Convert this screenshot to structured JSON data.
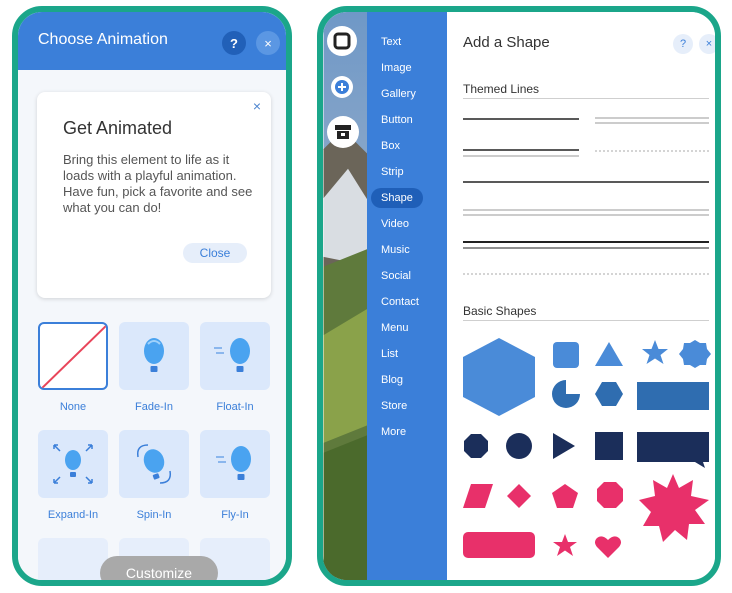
{
  "animation_panel": {
    "title": "Choose Animation",
    "help_label": "?",
    "close_label": "×",
    "tip": {
      "close_x": "×",
      "title": "Get Animated",
      "text": "Bring this element to life as it loads with a playful animation. Have fun, pick a favorite and see what you can do!",
      "close_button": "Close"
    },
    "animations": [
      {
        "label": "None",
        "icon": "none-slash-icon",
        "selected": true
      },
      {
        "label": "Fade-In",
        "icon": "balloon-icon"
      },
      {
        "label": "Float-In",
        "icon": "float-balloon-icon"
      },
      {
        "label": "Expand-In",
        "icon": "expand-balloon-icon"
      },
      {
        "label": "Spin-In",
        "icon": "spin-balloon-icon"
      },
      {
        "label": "Fly-In",
        "icon": "fly-balloon-icon"
      }
    ],
    "customize_button": "Customize"
  },
  "editor": {
    "add_menu": {
      "items": [
        "Text",
        "Image",
        "Gallery",
        "Button",
        "Box",
        "Strip",
        "Shape",
        "Video",
        "Music",
        "Social",
        "Contact",
        "Menu",
        "List",
        "Blog",
        "Store",
        "More"
      ],
      "active": "Shape"
    },
    "shape_panel": {
      "title": "Add a Shape",
      "help_label": "?",
      "close_label": "×",
      "themed_lines_title": "Themed Lines",
      "basic_shapes_title": "Basic Shapes"
    },
    "colors": {
      "accent_blue": "#3b7fd9",
      "shape_blue": "#4a8bd8",
      "dark_navy": "#1b2e5a",
      "pink": "#e8306a",
      "frame_teal": "#1ba68a"
    }
  }
}
